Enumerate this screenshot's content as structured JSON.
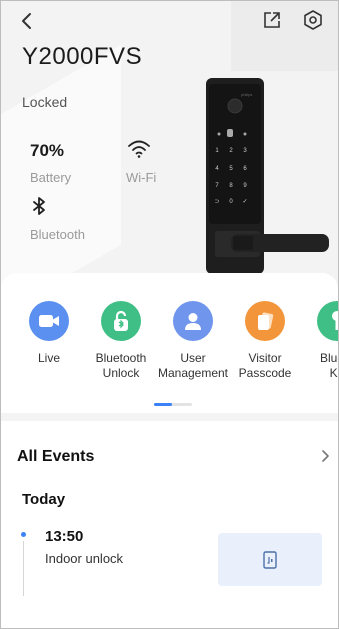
{
  "header": {
    "device_name": "Y2000FVS",
    "lock_status": "Locked",
    "back_icon": "chevron-left-icon",
    "share_icon": "share-external-icon",
    "settings_icon": "hexagon-gear-icon"
  },
  "status": {
    "battery_value": "70%",
    "battery_label": "Battery",
    "wifi_label": "Wi-Fi",
    "bluetooth_label": "Bluetooth"
  },
  "actions": [
    {
      "label": "Live",
      "icon": "video-camera-icon",
      "color": "#5b8ff0"
    },
    {
      "label": "Bluetooth\nUnlock",
      "icon": "bluetooth-unlock-icon",
      "color": "#3fbf86"
    },
    {
      "label": "User\nManagement",
      "icon": "user-icon",
      "color": "#6f95ec"
    },
    {
      "label": "Visitor\nPasscode",
      "icon": "cards-icon",
      "color": "#f3953a"
    },
    {
      "label": "Blueto\nKe",
      "icon": "bluetooth-key-icon",
      "color": "#3fbf86"
    }
  ],
  "events": {
    "title": "All Events",
    "day": "Today",
    "items": [
      {
        "time": "13:50",
        "description": "Indoor unlock",
        "thumb_icon": "door-icon"
      }
    ]
  },
  "colors": {
    "accent": "#3b82f6",
    "thumb_bg": "#e9f0fb"
  }
}
